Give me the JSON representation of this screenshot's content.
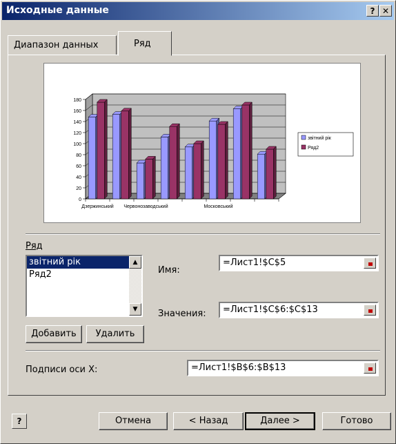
{
  "window": {
    "title": "Исходные данные",
    "help_glyph": "?",
    "close_glyph": "✕"
  },
  "tabs": [
    {
      "label": "Диапазон данных"
    },
    {
      "label": "Ряд"
    }
  ],
  "chart_data": {
    "type": "bar",
    "categories": [
      "Дзержинський",
      "",
      "Червонозаводський",
      "",
      "",
      "Московський",
      "",
      ""
    ],
    "x_tick_labels": [
      "Дзержинський",
      "Червонозаводський",
      "Московський"
    ],
    "series": [
      {
        "name": "звітний рік",
        "values": [
          148,
          153,
          65,
          112,
          94,
          141,
          163,
          81
        ],
        "color": "#9999ff"
      },
      {
        "name": "Ряд2",
        "values": [
          175,
          159,
          72,
          131,
          100,
          135,
          170,
          90
        ],
        "color": "#993366"
      }
    ],
    "yticks": [
      0,
      20,
      40,
      60,
      80,
      100,
      120,
      140,
      160,
      180
    ],
    "ylim": [
      0,
      180
    ],
    "grid": true,
    "legend": "right",
    "style": "3d"
  },
  "series_section": {
    "label": "Ряд",
    "items": [
      {
        "label": "звітний рік",
        "selected": true
      },
      {
        "label": "Ряд2",
        "selected": false
      }
    ],
    "add_button": "Добавить",
    "remove_button": "Удалить"
  },
  "name_field": {
    "label": "Имя:",
    "value": "=Лист1!$C$5"
  },
  "values_field": {
    "label": "Значения:",
    "value": "=Лист1!$C$6:$C$13"
  },
  "xaxis_field": {
    "label": "Подписи оси X:",
    "value": "=Лист1!$B$6:$B$13"
  },
  "footer": {
    "cancel": "Отмена",
    "back": "< Назад",
    "next": "Далее >",
    "finish": "Готово",
    "help_icon": "?"
  }
}
